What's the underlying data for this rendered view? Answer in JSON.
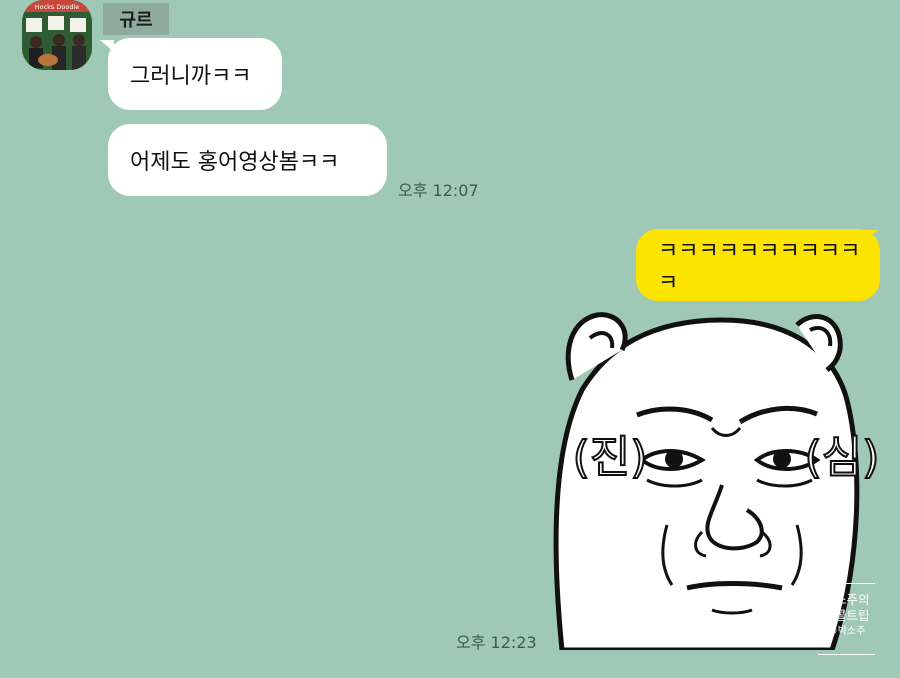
{
  "chat": {
    "sender_name": "규르",
    "messages_in": [
      {
        "text": "그러니까ㅋㅋ"
      },
      {
        "text": "어제도 홍어영상봄ㅋㅋ",
        "time": "오후 12:07"
      }
    ],
    "message_out": {
      "text": "ㅋㅋㅋㅋㅋㅋㅋㅋㅋㅋㅋ"
    },
    "sticker": {
      "time": "오후 12:23",
      "left_text": "(진)",
      "right_text": "(심)",
      "watermark_line1": "박소주의",
      "watermark_line2": "알콜트립",
      "watermark_line3": "©박소주"
    },
    "avatar": {
      "sign_text": "Hocks Doodle"
    }
  },
  "colors": {
    "background": "#9fc8b7",
    "out_bubble": "#fde300",
    "in_bubble": "#ffffff"
  }
}
